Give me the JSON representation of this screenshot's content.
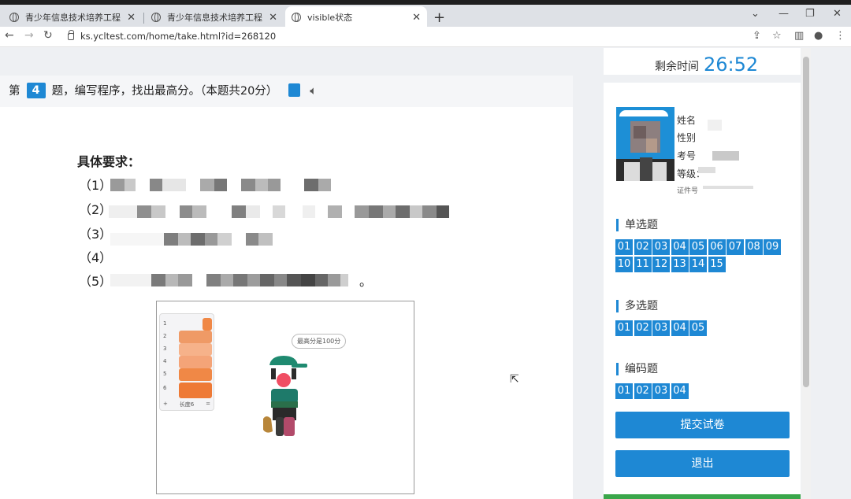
{
  "browser": {
    "tabs": [
      {
        "title": "青少年信息技术培养工程",
        "active": false
      },
      {
        "title": "青少年信息技术培养工程",
        "active": false
      },
      {
        "title": "visible状态",
        "active": true
      }
    ],
    "url": "ks.ycltest.com/home/take.html?id=268120"
  },
  "question": {
    "prefix": "第",
    "number": "4",
    "text": "题，编写程序，找出最高分。（本题共20分）",
    "requirements_title": "具体要求：",
    "items": [
      "（1）",
      "（2）",
      "（3）",
      "（4）",
      "（5）"
    ],
    "item5_tail": "。"
  },
  "stage": {
    "speech": "最高分是100分",
    "list_indices": [
      "1",
      "2",
      "3",
      "4",
      "5",
      "6"
    ],
    "list_footer_left": "+",
    "list_footer_label": "长度6",
    "list_footer_right": "="
  },
  "sidebar": {
    "timer_label": "剩余时间",
    "timer_value": "26:52",
    "info": {
      "name_label": "姓名",
      "gender_label": "性别",
      "exam_label": "考号",
      "level_label": "等级：",
      "id_label": "证件号"
    },
    "sections": [
      {
        "title": "单选题",
        "items": [
          "01",
          "02",
          "03",
          "04",
          "05",
          "06",
          "07",
          "08",
          "09",
          "10",
          "11",
          "12",
          "13",
          "14",
          "15"
        ]
      },
      {
        "title": "多选题",
        "items": [
          "01",
          "02",
          "03",
          "04",
          "05"
        ]
      },
      {
        "title": "编码题",
        "items": [
          "01",
          "02",
          "03",
          "04"
        ]
      }
    ],
    "submit_label": "提交试卷",
    "exit_label": "退出"
  },
  "colors": {
    "accent": "#1e88d4",
    "bar": "#f08846",
    "green": "#3aa64a"
  }
}
